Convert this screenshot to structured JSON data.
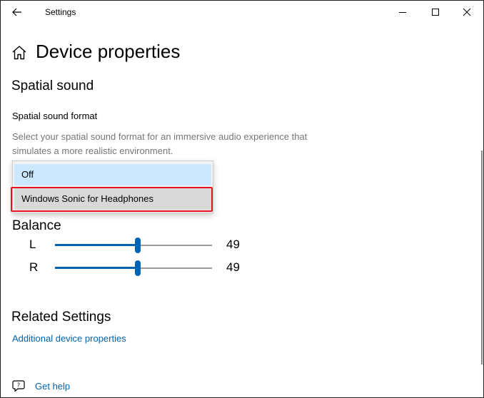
{
  "window": {
    "title": "Settings",
    "icons": {
      "back": "back-arrow-icon",
      "minimize": "minimize-icon",
      "maximize": "maximize-icon",
      "close": "close-icon"
    }
  },
  "header": {
    "icon": "home-icon",
    "title": "Device properties"
  },
  "spatial_sound": {
    "heading": "Spatial sound",
    "format_label": "Spatial sound format",
    "description": "Select your spatial sound format for an immersive audio experience that simulates a more realistic environment.",
    "dropdown": {
      "options": [
        "Off",
        "Windows Sonic for Headphones"
      ],
      "hovered": "Off",
      "highlighted": "Windows Sonic for Headphones"
    }
  },
  "balance": {
    "heading": "Balance",
    "channels": [
      {
        "label": "L",
        "value": "49",
        "level": 49,
        "max": 100
      },
      {
        "label": "R",
        "value": "49",
        "level": 49,
        "max": 100
      }
    ]
  },
  "related": {
    "heading": "Related Settings",
    "link": "Additional device properties"
  },
  "help": {
    "icon": "help-chat-icon",
    "label": "Get help"
  },
  "colors": {
    "accent": "#0063b1",
    "highlight_border": "#e81123",
    "hover_option": "#cce8ff",
    "description_text": "#767676"
  }
}
